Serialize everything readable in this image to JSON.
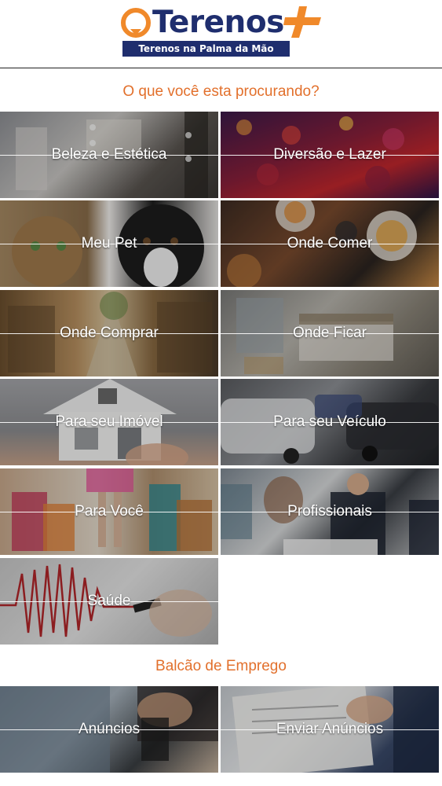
{
  "header": {
    "logo_word": "Terenos",
    "logo_tagline": "Terenos na Palma da Mão",
    "brand_navy": "#1f2e6e",
    "brand_orange": "#f0892a"
  },
  "sections": {
    "search_title": "O que você esta procurando?",
    "jobs_title": "Balcão de Emprego",
    "accent": "#e2702c"
  },
  "categories": [
    {
      "label": "Beleza e Estética"
    },
    {
      "label": "Diversão e Lazer"
    },
    {
      "label": "Meu Pet"
    },
    {
      "label": "Onde Comer"
    },
    {
      "label": "Onde Comprar"
    },
    {
      "label": "Onde Ficar"
    },
    {
      "label": "Para seu Imóvel"
    },
    {
      "label": "Para seu Veículo"
    },
    {
      "label": "Para Você"
    },
    {
      "label": "Profissionais"
    },
    {
      "label": "Saúde"
    }
  ],
  "jobs": [
    {
      "label": "Anúncios"
    },
    {
      "label": "Enviar Anúncios"
    }
  ]
}
